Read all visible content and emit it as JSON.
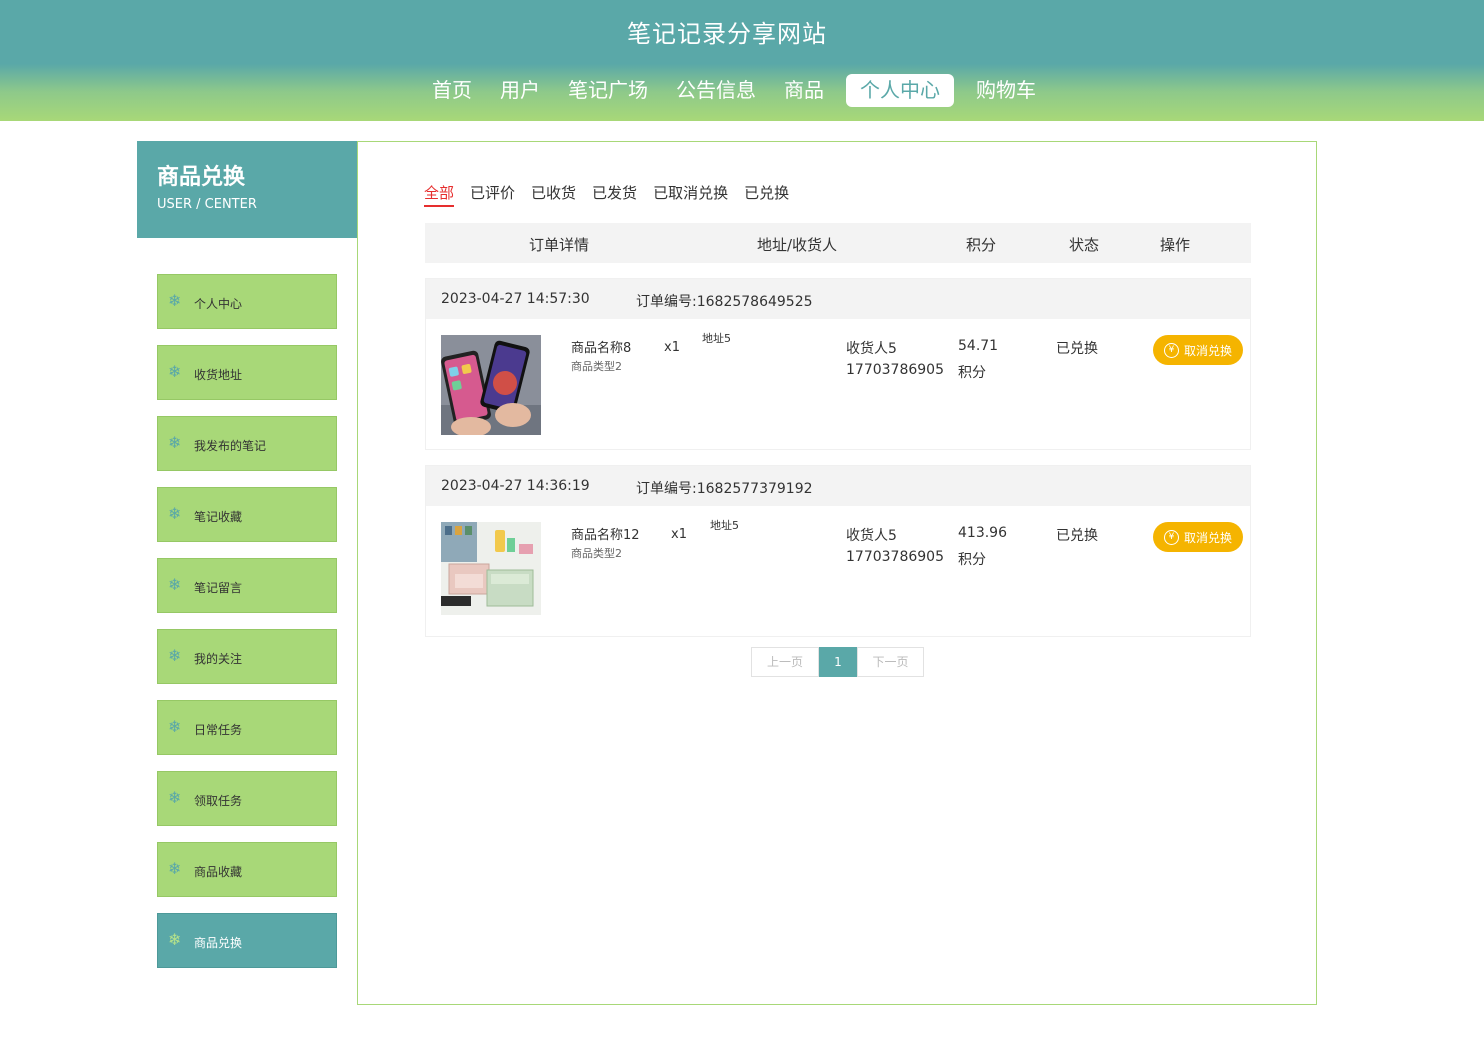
{
  "header": {
    "site_title": "笔记记录分享网站",
    "nav": [
      {
        "label": "首页"
      },
      {
        "label": "用户"
      },
      {
        "label": "笔记广场"
      },
      {
        "label": "公告信息"
      },
      {
        "label": "商品"
      },
      {
        "label": "个人中心",
        "active": true
      },
      {
        "label": "购物车"
      }
    ]
  },
  "sidebar": {
    "title": "商品兑换",
    "subtitle": "USER / CENTER",
    "items": [
      {
        "label": "个人中心"
      },
      {
        "label": "收货地址"
      },
      {
        "label": "我发布的笔记"
      },
      {
        "label": "笔记收藏"
      },
      {
        "label": "笔记留言"
      },
      {
        "label": "我的关注"
      },
      {
        "label": "日常任务"
      },
      {
        "label": "领取任务"
      },
      {
        "label": "商品收藏"
      },
      {
        "label": "商品兑换",
        "active": true
      }
    ]
  },
  "tabs": [
    {
      "label": "全部",
      "active": true
    },
    {
      "label": "已评价"
    },
    {
      "label": "已收货"
    },
    {
      "label": "已发货"
    },
    {
      "label": "已取消兑换"
    },
    {
      "label": "已兑换"
    }
  ],
  "table_header": {
    "detail": "订单详情",
    "address": "地址/收货人",
    "points": "积分",
    "status": "状态",
    "action": "操作"
  },
  "orders": [
    {
      "datetime": "2023-04-27 14:57:30",
      "order_no": "订单编号:1682578649525",
      "product_name": "商品名称8",
      "product_type": "商品类型2",
      "quantity": "x1",
      "address": "地址5",
      "receiver": "收货人5",
      "phone": "17703786905",
      "points": "54.71",
      "points_unit": "积分",
      "status": "已兑换",
      "action_label": "取消兑换",
      "image_icon": "phones-image"
    },
    {
      "datetime": "2023-04-27 14:36:19",
      "order_no": "订单编号:1682577379192",
      "product_name": "商品名称12",
      "product_type": "商品类型2",
      "quantity": "x1",
      "address": "地址5",
      "receiver": "收货人5",
      "phone": "17703786905",
      "points": "413.96",
      "points_unit": "积分",
      "status": "已兑换",
      "action_label": "取消兑换",
      "image_icon": "storage-box-image"
    }
  ],
  "pagination": {
    "prev": "上一页",
    "current": "1",
    "next": "下一页"
  },
  "colors": {
    "primary": "#5aa8a8",
    "accent_green": "#a8d878",
    "active_tab": "#e62e2e",
    "action_button": "#f5b400"
  }
}
